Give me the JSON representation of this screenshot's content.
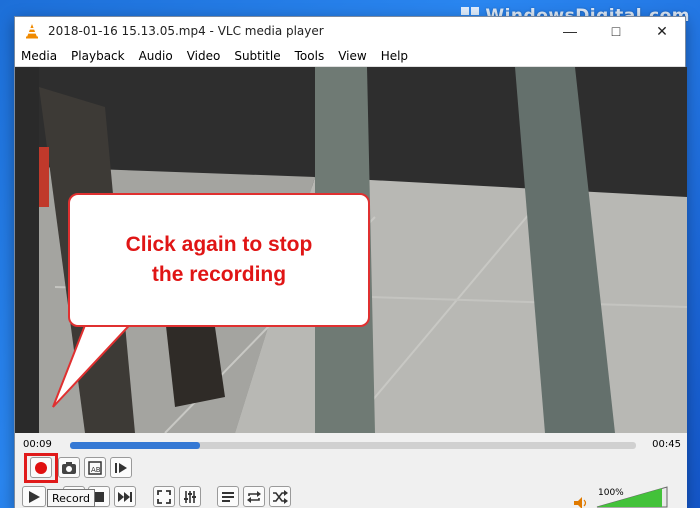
{
  "watermark": "WindowsDigital.com",
  "window": {
    "title": "2018-01-16 15.13.05.mp4 - VLC media player",
    "controls": [
      "minimize-icon",
      "maximize-icon",
      "close-icon"
    ]
  },
  "menu": [
    "Media",
    "Playback",
    "Audio",
    "Video",
    "Subtitle",
    "Tools",
    "View",
    "Help"
  ],
  "callout": {
    "line1": "Click again to stop",
    "line2": "the recording",
    "color": "#e01515"
  },
  "player": {
    "current_time": "00:09",
    "total_time": "00:45",
    "progress": 0.23,
    "volume_label": "100%",
    "volume": 1.0,
    "tooltip": "Record",
    "record_highlight_color": "#e01a1a",
    "accent": "#3478d4"
  },
  "icons": {
    "row1": [
      "record-icon",
      "snapshot-icon",
      "loop-ab-icon",
      "frame-step-icon"
    ],
    "row2": [
      "play-icon",
      "previous-icon",
      "stop-icon",
      "next-icon",
      "fullscreen-icon",
      "extended-settings-icon",
      "playlist-icon",
      "loop-icon",
      "shuffle-icon"
    ]
  }
}
